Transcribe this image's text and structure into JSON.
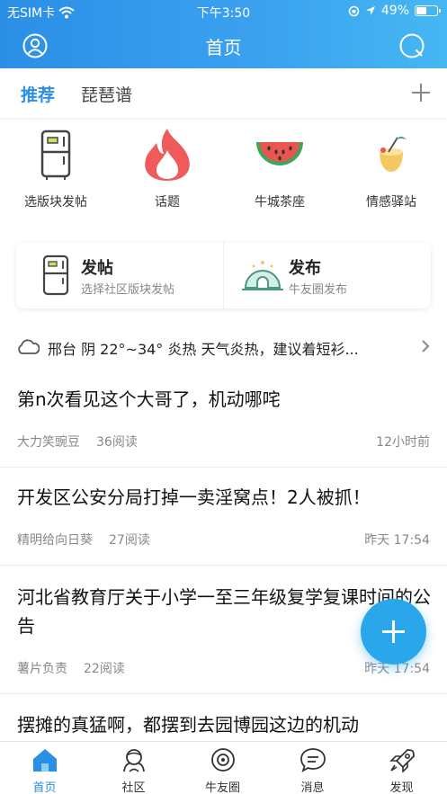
{
  "status_bar": {
    "carrier": "无SIM卡",
    "time": "下午3:50",
    "battery": "49%"
  },
  "nav": {
    "title": "首页",
    "left_icon": "user-icon",
    "right_icon": "search-icon"
  },
  "tabs": [
    {
      "label": "推荐",
      "active": true
    },
    {
      "label": "琵琶谱",
      "active": false
    }
  ],
  "quick_actions": [
    {
      "label": "选版块发帖",
      "icon": "fridge-icon"
    },
    {
      "label": "话题",
      "icon": "flame-icon"
    },
    {
      "label": "牛城茶座",
      "icon": "watermelon-icon"
    },
    {
      "label": "情感驿站",
      "icon": "coconut-drink-icon"
    }
  ],
  "post_card": {
    "left": {
      "title": "发帖",
      "subtitle": "选择社区版块发帖"
    },
    "right": {
      "title": "发布",
      "subtitle": "牛友圈发布"
    }
  },
  "weather": {
    "text": "邢台 阴 22°~34° 炎热 天气炎热，建议着短衫..."
  },
  "articles": [
    {
      "title": "第n次看见这个大哥了，机动哪咤",
      "author": "大力笑豌豆",
      "reads": "36阅读",
      "time": "12小时前"
    },
    {
      "title": "开发区公安分局打掉一卖淫窝点！2人被抓！",
      "author": "精明给向日葵",
      "reads": "27阅读",
      "time": "昨天 17:54"
    },
    {
      "title": "河北省教育厅关于小学一至三年级复学复课时间的公告",
      "author": "薯片负责",
      "reads": "22阅读",
      "time": "昨天 17:54"
    },
    {
      "title": "摆摊的真猛啊，都摆到去园博园这边的机动",
      "author": "",
      "reads": "",
      "time": ""
    }
  ],
  "tabbar": [
    {
      "label": "首页",
      "icon": "home-icon",
      "active": true
    },
    {
      "label": "社区",
      "icon": "community-icon",
      "active": false
    },
    {
      "label": "牛友圈",
      "icon": "friends-circle-icon",
      "active": false
    },
    {
      "label": "消息",
      "icon": "message-icon",
      "active": false
    },
    {
      "label": "发现",
      "icon": "rocket-icon",
      "active": false
    }
  ],
  "colors": {
    "header_start": "#2b8fe6",
    "header_end": "#45b7f2",
    "accent": "#2b8fe6",
    "fab": "#29a7ea"
  }
}
